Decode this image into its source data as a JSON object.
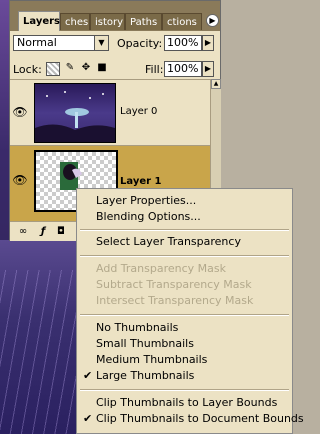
{
  "tabs": [
    {
      "label": "Layers",
      "active": true
    },
    {
      "label": "ches",
      "active": false
    },
    {
      "label": "istory",
      "active": false
    },
    {
      "label": "Paths",
      "active": false
    },
    {
      "label": "ctions",
      "active": false
    }
  ],
  "blend_mode": {
    "value": "Normal"
  },
  "opacity": {
    "label": "Opacity:",
    "value": "100%"
  },
  "lock": {
    "label": "Lock:"
  },
  "fill": {
    "label": "Fill:",
    "value": "100%"
  },
  "layers": [
    {
      "name": "Layer 0",
      "visible": true,
      "selected": false
    },
    {
      "name": "Layer 1",
      "visible": true,
      "selected": true
    }
  ],
  "context_menu": {
    "group1": [
      "Layer Properties...",
      "Blending Options..."
    ],
    "group2": [
      "Select Layer Transparency"
    ],
    "group3": [
      "Add Transparency Mask",
      "Subtract Transparency Mask",
      "Intersect Transparency Mask"
    ],
    "group4": [
      "No Thumbnails",
      "Small Thumbnails",
      "Medium Thumbnails",
      "Large Thumbnails"
    ],
    "group5": [
      "Clip Thumbnails to Layer Bounds",
      "Clip Thumbnails to Document Bounds"
    ],
    "checked": [
      "Large Thumbnails",
      "Clip Thumbnails to Document Bounds"
    ]
  },
  "colors": {
    "panel": "#ece2c4",
    "tabbar": "#8a7a5a",
    "selected_row": "#c9a54a",
    "disabled_text": "#b3a98c"
  }
}
